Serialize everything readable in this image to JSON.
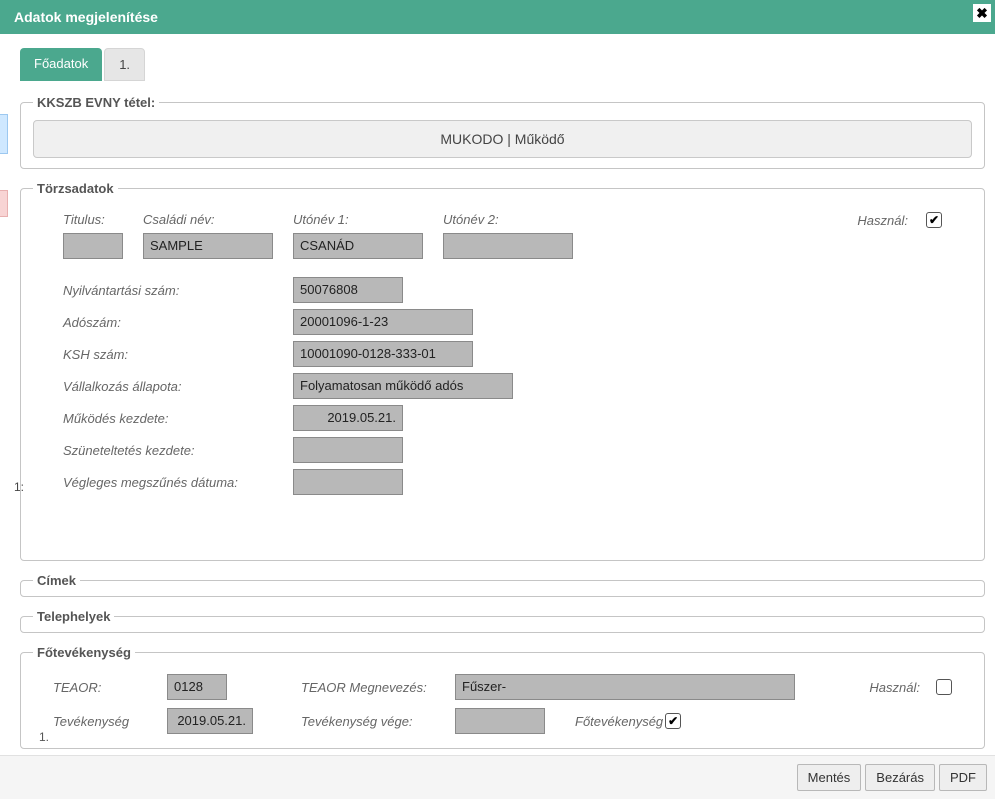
{
  "header": {
    "title": "Adatok megjelenítése"
  },
  "tabs": {
    "main": "Főadatok",
    "second": "1."
  },
  "kkszb": {
    "legend": "KKSZB EVNY tétel:",
    "body": "MUKODO | Működő"
  },
  "torzs": {
    "legend": "Törzsadatok",
    "labels": {
      "titulus": "Titulus:",
      "csaladi": "Családi név:",
      "utonev1": "Utónév 1:",
      "utonev2": "Utónév 2:",
      "hasznal": "Használ:",
      "nyilv": "Nyilvántartási szám:",
      "adoszam": "Adószám:",
      "ksh": "KSH szám:",
      "allapot": "Vállalkozás állapota:",
      "mukodes_kezd": "Működés kezdete:",
      "szunet": "Szüneteltetés kezdete:",
      "vegleges": "Végleges megszűnés dátuma:"
    },
    "values": {
      "titulus": "",
      "csaladi": "SAMPLE",
      "utonev1": "CSANÁD",
      "utonev2": "",
      "hasznal_checked": "✔",
      "nyilv": "50076808",
      "adoszam": "20001096-1-23",
      "ksh": "10001090-0128-333-01",
      "allapot": "Folyamatosan működő adós",
      "mukodes_kezd": "2019.05.21.",
      "szunet": "",
      "vegleges": ""
    }
  },
  "left_marker": "1:",
  "cimek": {
    "legend": "Címek"
  },
  "telephelyek": {
    "legend": "Telephelyek"
  },
  "fotevekenyseg": {
    "legend": "Főtevékenység",
    "labels": {
      "teaor": "TEAOR:",
      "teaor_megn": "TEAOR Megnevezés:",
      "hasznal": "Használ:",
      "tev_kezd": "Tevékenység",
      "tev_vege": "Tevékenység vége:",
      "fotev": "Főtevékenység"
    },
    "values": {
      "teaor": "0128",
      "teaor_megn": "Fűszer-",
      "hasznal_checked": "",
      "tev_kezd": "2019.05.21.",
      "tev_vege": "",
      "fotev_checked": "✔"
    },
    "row_marker": "1."
  },
  "footer": {
    "save": "Mentés",
    "close": "Bezárás",
    "pdf": "PDF"
  }
}
